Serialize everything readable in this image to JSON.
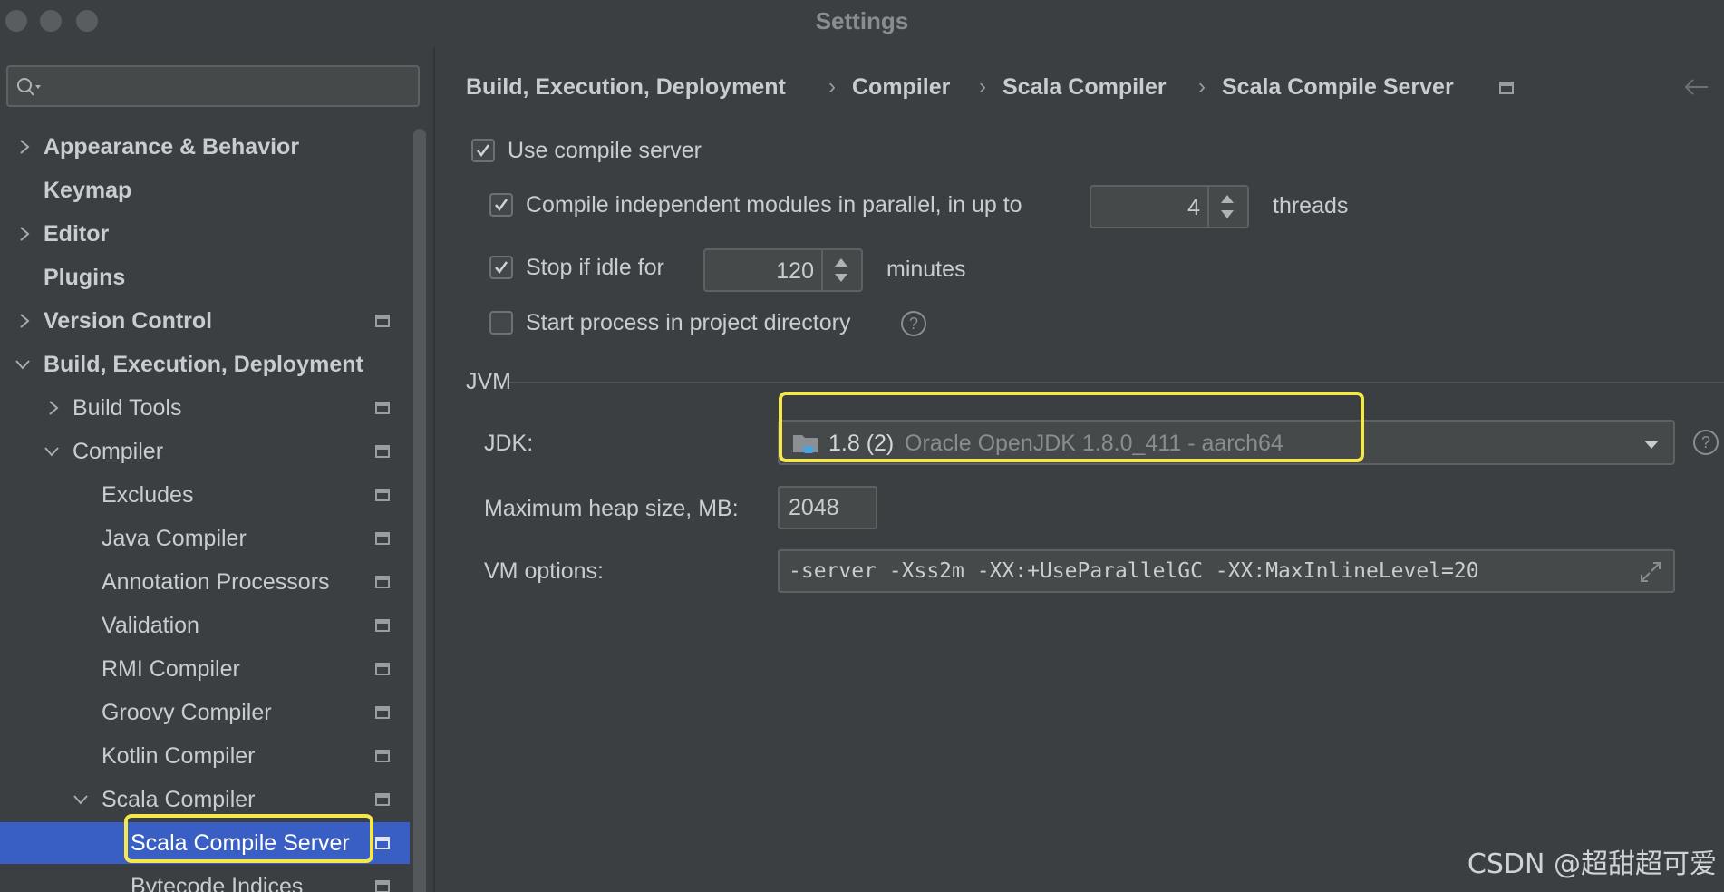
{
  "window": {
    "title": "Settings"
  },
  "search": {
    "placeholder": ""
  },
  "sidebar": {
    "items": [
      {
        "label": "Appearance & Behavior"
      },
      {
        "label": "Keymap"
      },
      {
        "label": "Editor"
      },
      {
        "label": "Plugins"
      },
      {
        "label": "Version Control"
      },
      {
        "label": "Build, Execution, Deployment"
      },
      {
        "label": "Build Tools"
      },
      {
        "label": "Compiler"
      },
      {
        "label": "Excludes"
      },
      {
        "label": "Java Compiler"
      },
      {
        "label": "Annotation Processors"
      },
      {
        "label": "Validation"
      },
      {
        "label": "RMI Compiler"
      },
      {
        "label": "Groovy Compiler"
      },
      {
        "label": "Kotlin Compiler"
      },
      {
        "label": "Scala Compiler"
      },
      {
        "label": "Scala Compile Server"
      },
      {
        "label": "Bytecode Indices"
      }
    ]
  },
  "breadcrumb": [
    "Build, Execution, Deployment",
    "Compiler",
    "Scala Compiler",
    "Scala Compile Server"
  ],
  "settings": {
    "use_compile_server": "Use compile server",
    "parallel_label": "Compile independent modules in parallel, in up to",
    "parallel_threads": "4",
    "threads_label": "threads",
    "idle_label": "Stop if idle for",
    "idle_minutes": "120",
    "minutes_label": "minutes",
    "project_dir_label": "Start process in project directory",
    "help_glyph": "?"
  },
  "jvm": {
    "section_title": "JVM",
    "jdk_label": "JDK:",
    "jdk_name": "1.8 (2)",
    "jdk_desc": "Oracle OpenJDK 1.8.0_411 - aarch64",
    "heap_label": "Maximum heap size, MB:",
    "heap_value": "2048",
    "vm_label": "VM options:",
    "vm_value": "-server -Xss2m -XX:+UseParallelGC -XX:MaxInlineLevel=20"
  },
  "watermark": "CSDN @超甜超可爱",
  "colors": {
    "accent": "#3a5fc4",
    "highlight": "#f4e84a",
    "background": "#3c3f41"
  }
}
